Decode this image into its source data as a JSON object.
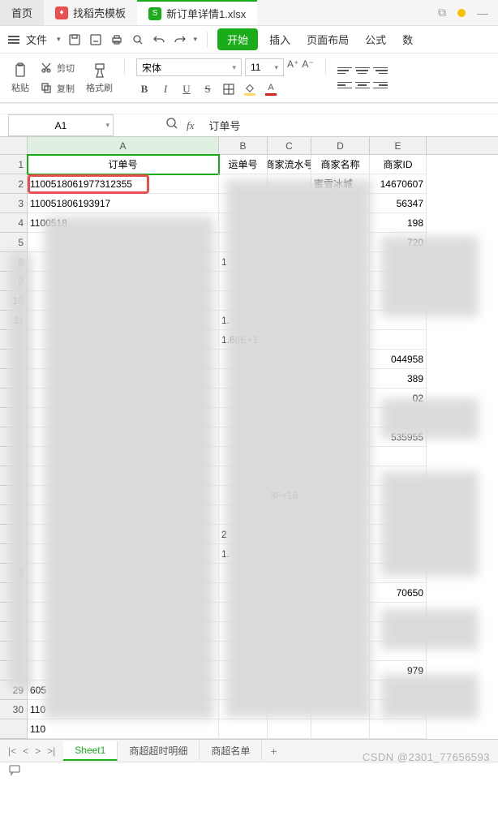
{
  "tabs": {
    "home": "首页",
    "template": "找稻壳模板",
    "file": "新订单详情1.xlsx"
  },
  "menu": {
    "file": "文件",
    "start": "开始",
    "insert": "插入",
    "page_layout": "页面布局",
    "formula": "公式",
    "data": "数"
  },
  "toolbar": {
    "paste": "粘贴",
    "cut": "剪切",
    "copy": "复制",
    "format_painter": "格式刷",
    "font_name": "宋体",
    "font_size": "11"
  },
  "namebox": {
    "ref": "A1",
    "fx": "fx",
    "value": "订单号"
  },
  "columns": {
    "A": "A",
    "B": "B",
    "C": "C",
    "D": "D",
    "E": "E"
  },
  "headers": {
    "A": "订单号",
    "B": "运单号",
    "C": "商家流水号",
    "D": "商家名称",
    "E": "商家ID"
  },
  "data_rows": [
    {
      "n": "2",
      "A": "1100518061977312355",
      "D": "蜜雪冰城",
      "E": "14670607"
    },
    {
      "n": "3",
      "A": "110051806193917",
      "E": "56347"
    },
    {
      "n": "4",
      "A": "1100518",
      "E": "198"
    },
    {
      "n": "5",
      "A": "",
      "E": "720"
    }
  ],
  "visible_row_nums": [
    "8",
    "9",
    "10",
    "11",
    "",
    "",
    "",
    "",
    "",
    "",
    "",
    "",
    "",
    "",
    "",
    "",
    "2",
    "",
    "",
    "",
    "",
    "",
    "29",
    "30"
  ],
  "fragments": {
    "b5": "1",
    "b8": "1.",
    "b9": "1.68E+1",
    "e10": "044958",
    "e11": "389",
    "e12": "02",
    "e14": "535955",
    "c17": "3F+18",
    "b19": "2",
    "b20": "1.",
    "e22": "70650",
    "e26": "979",
    "a27": "605",
    "a28": "110",
    "a30": "110"
  },
  "sheets": {
    "s1": "Sheet1",
    "s2": "商超超时明细",
    "s3": "商超名单"
  },
  "watermark": "CSDN @2301_77656593"
}
